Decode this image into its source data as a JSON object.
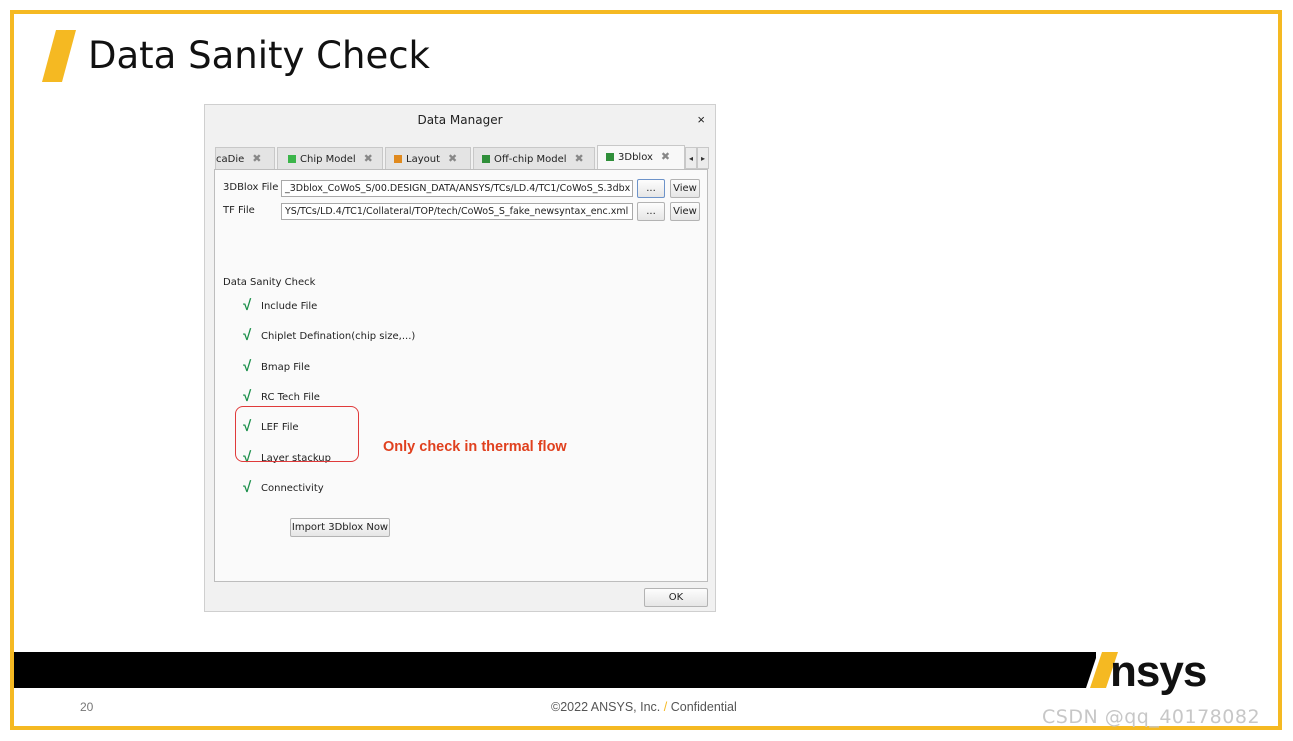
{
  "slide": {
    "title": "Data Sanity Check",
    "page_number": "20",
    "copyright_prefix": "©2022 ANSYS, Inc.",
    "copyright_sep": "/",
    "copyright_suffix": "Confidential",
    "logo_text": "nsys",
    "watermark": "CSDN @qq_40178082",
    "accent_color": "#f5b922"
  },
  "dialog": {
    "title": "Data Manager",
    "close_label": "×",
    "tabs": [
      {
        "label": "caDie",
        "close": "✖",
        "icon_color": "#d33"
      },
      {
        "label": "Chip Model",
        "close": "✖",
        "icon_color": "#3bb54a"
      },
      {
        "label": "Layout",
        "close": "✖",
        "icon_color": "#e08a1e"
      },
      {
        "label": "Off-chip Model",
        "close": "✖",
        "icon_color": "#2f8f3a"
      },
      {
        "label": "3Dblox",
        "close": "✖",
        "icon_color": "#2f8f3a"
      }
    ],
    "tab_scroll_left": "◂",
    "tab_scroll_right": "▸",
    "fields": {
      "file_3dblox_label": "3DBlox File",
      "file_3dblox_value": "_3Dblox_CoWoS_S/00.DESIGN_DATA/ANSYS/TCs/LD.4/TC1/CoWoS_S.3dbx",
      "tf_label": "TF File",
      "tf_value": "YS/TCs/LD.4/TC1/Collateral/TOP/tech/CoWoS_S_fake_newsyntax_enc.xml",
      "browse_label": "...",
      "view_label": "View"
    },
    "check_section_title": "Data Sanity Check",
    "check_mark": "√",
    "checks": [
      "Include File",
      "Chiplet Defination(chip size,...)",
      "Bmap File",
      "RC Tech File",
      "LEF File",
      "Layer stackup",
      "Connectivity"
    ],
    "thermal_note": "Only check in thermal flow",
    "import_button": "Import 3Dblox Now",
    "ok_button": "OK"
  }
}
